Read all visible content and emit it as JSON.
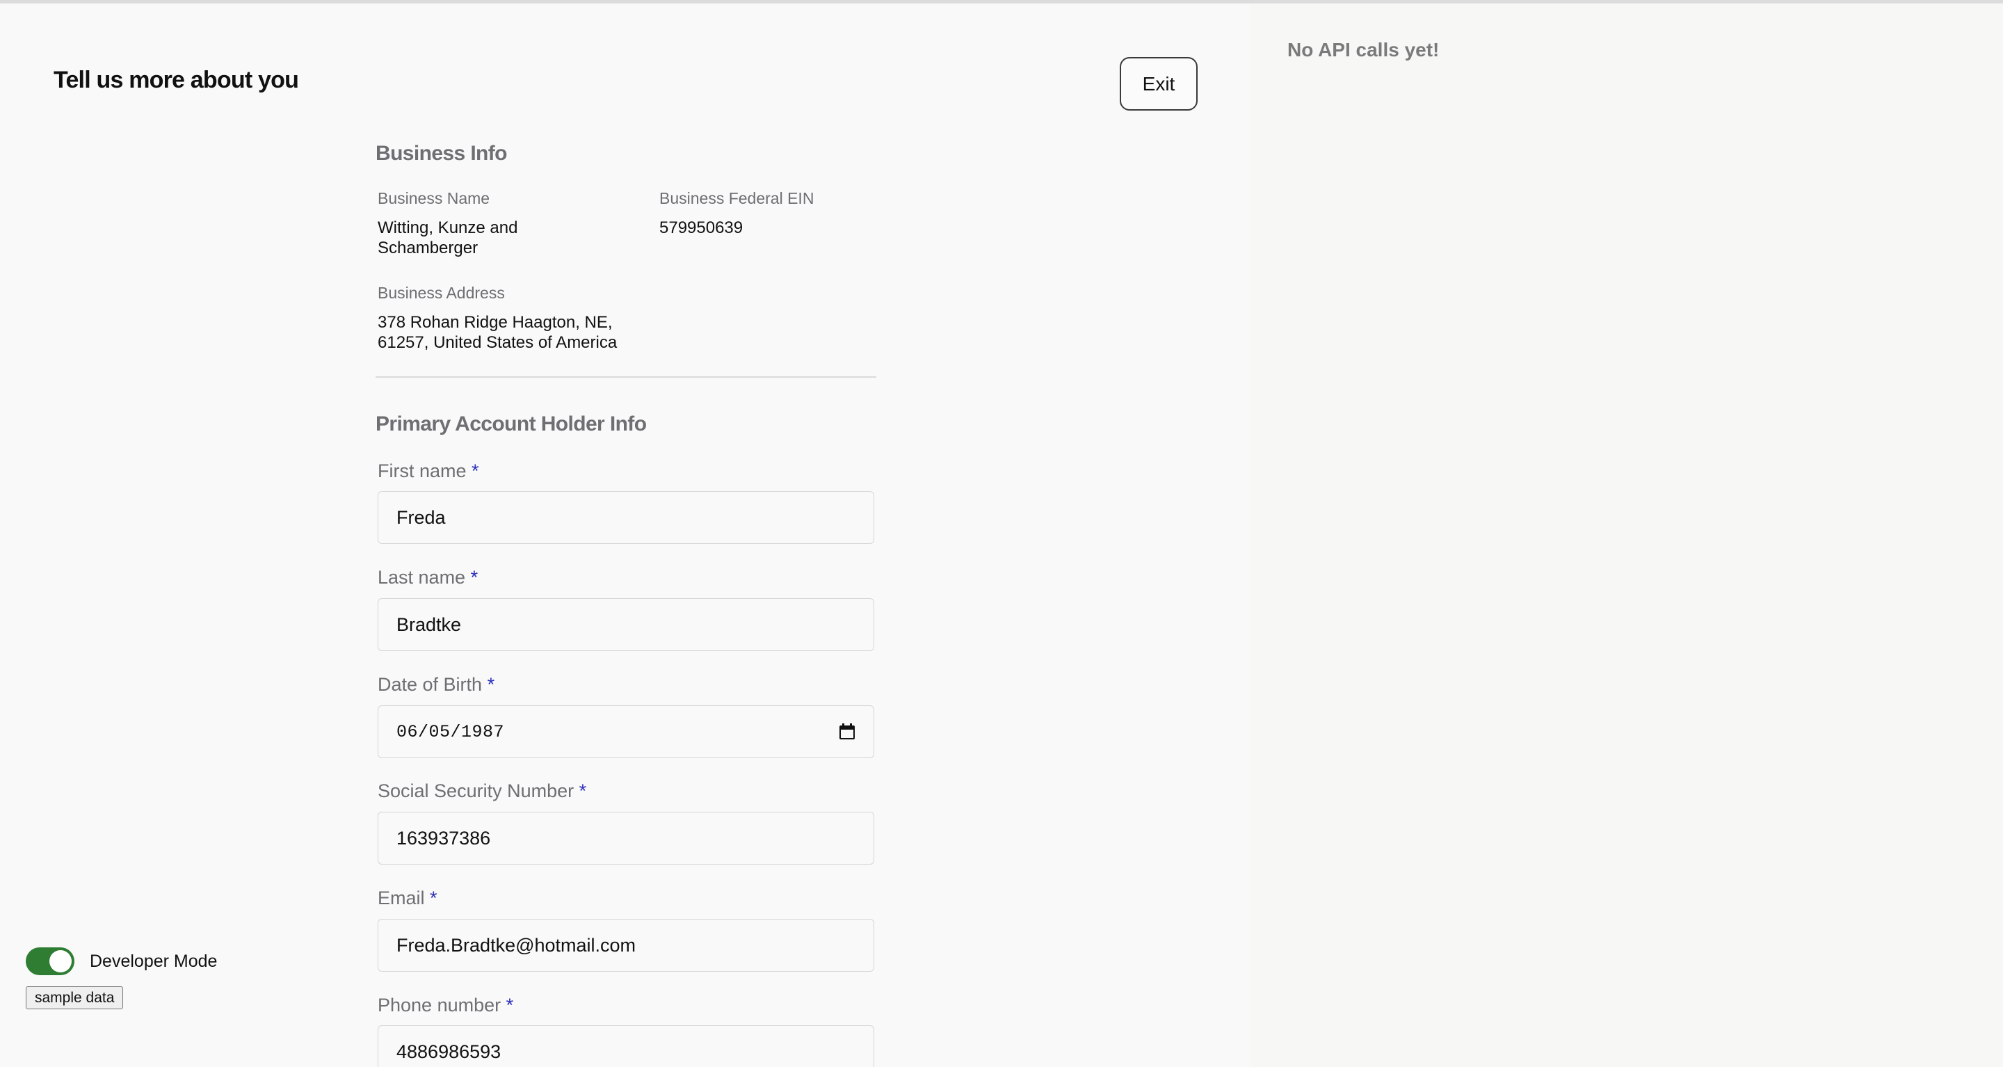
{
  "api_panel": {
    "empty_message": "No API calls yet!"
  },
  "header": {
    "title": "Tell us more about you",
    "exit_label": "Exit"
  },
  "business_info": {
    "section_title": "Business Info",
    "name_label": "Business Name",
    "name_value_line1": "Witting, Kunze and",
    "name_value_line2": "Schamberger",
    "ein_label": "Business Federal EIN",
    "ein_value": "579950639",
    "address_label": "Business Address",
    "address_line1": "378 Rohan Ridge Haagton, NE,",
    "address_line2": "61257, United States of America"
  },
  "holder_info": {
    "section_title": "Primary Account Holder Info",
    "required_mark": "*",
    "first_name": {
      "label": "First name",
      "value": "Freda"
    },
    "last_name": {
      "label": "Last name",
      "value": "Bradtke"
    },
    "dob": {
      "label": "Date of Birth",
      "value": "06/05/1987"
    },
    "ssn": {
      "label": "Social Security Number",
      "value": "163937386"
    },
    "email": {
      "label": "Email",
      "value": "Freda.Bradtke@hotmail.com"
    },
    "phone": {
      "label": "Phone number",
      "value": "4886986593"
    }
  },
  "dev_tools": {
    "toggle_label": "Developer Mode",
    "toggle_on": true,
    "sample_button_label": "sample data"
  },
  "colors": {
    "toggle_on": "#2e7d32",
    "required_mark": "#2b2fb9",
    "section_title": "#6e6e73"
  }
}
